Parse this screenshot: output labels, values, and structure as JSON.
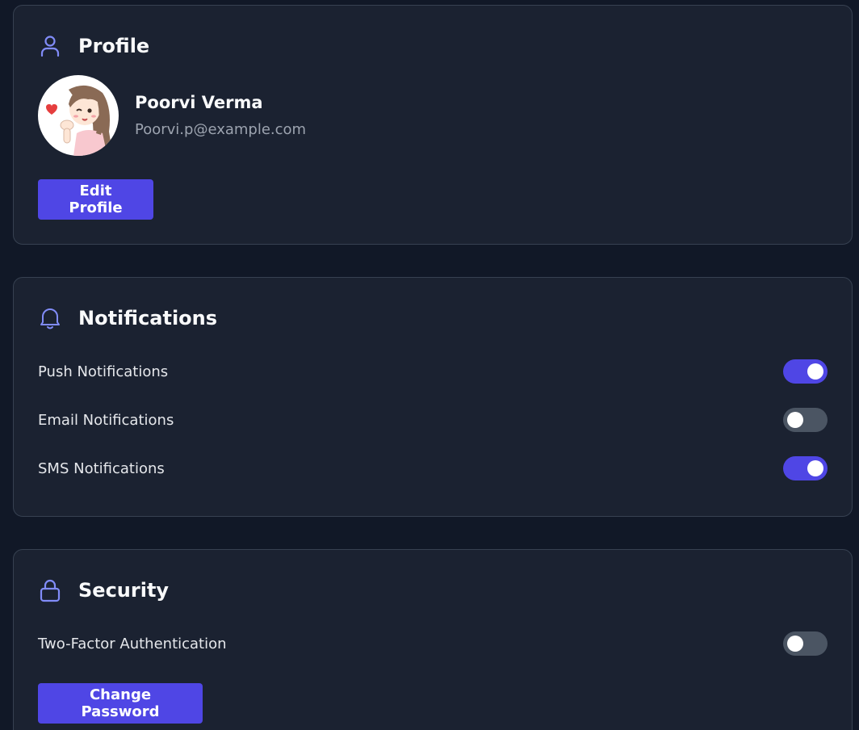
{
  "profile": {
    "title": "Profile",
    "icon": "user-icon",
    "name": "Poorvi Verma",
    "email": "Poorvi.p@example.com",
    "edit_label": "Edit Profile"
  },
  "notifications": {
    "title": "Notifications",
    "icon": "bell-icon",
    "items": [
      {
        "label": "Push Notifications",
        "enabled": true
      },
      {
        "label": "Email Notifications",
        "enabled": false
      },
      {
        "label": "SMS Notifications",
        "enabled": true
      }
    ]
  },
  "security": {
    "title": "Security",
    "icon": "lock-icon",
    "two_factor_label": "Two-Factor Authentication",
    "two_factor_enabled": false,
    "change_password_label": "Change Password"
  },
  "colors": {
    "accent": "#4f46e5",
    "icon": "#818cf8",
    "toggle_off": "#4b5563",
    "card": "#1b2231",
    "background": "#111827"
  }
}
